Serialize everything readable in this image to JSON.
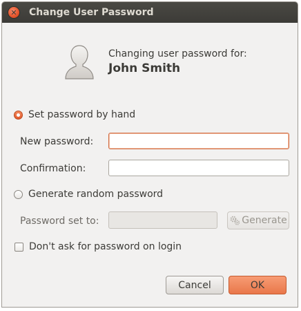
{
  "window": {
    "title": "Change User Password"
  },
  "header": {
    "line1": "Changing user password for:",
    "user_name": "John Smith"
  },
  "options": {
    "set_by_hand_label": "Set password by hand",
    "set_by_hand_selected": true,
    "new_password_label": "New password:",
    "new_password_value": "",
    "confirmation_label": "Confirmation:",
    "confirmation_value": "",
    "generate_random_label": "Generate random password",
    "generate_random_selected": false,
    "password_set_to_label": "Password set to:",
    "password_set_to_value": "",
    "generate_button_label": "Generate",
    "dont_ask_label": "Don't ask for password on login",
    "dont_ask_checked": false
  },
  "buttons": {
    "cancel": "Cancel",
    "ok": "OK"
  },
  "colors": {
    "accent": "#e9774a",
    "titlebar": "#3c3b37",
    "background": "#f2f1f0"
  }
}
